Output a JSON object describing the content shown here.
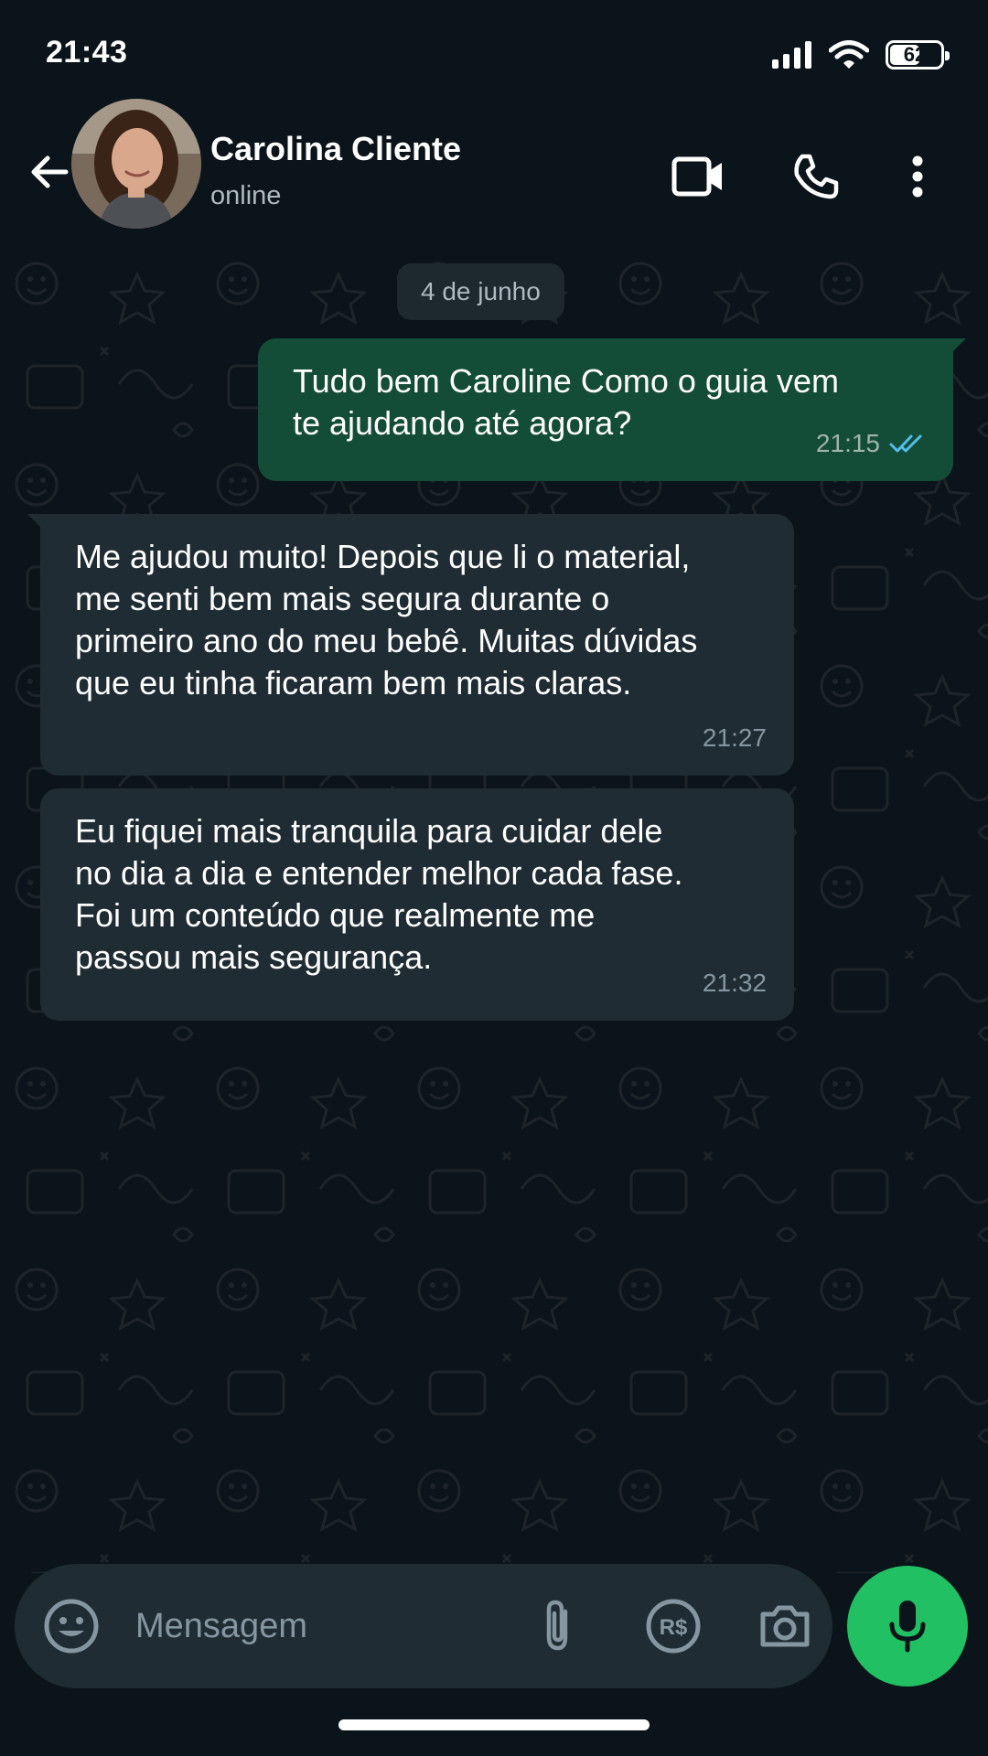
{
  "status_bar": {
    "time": "21:43",
    "battery_level": "62",
    "battery_fraction": 0.62,
    "icons": [
      "signal-icon",
      "wifi-icon",
      "battery-icon"
    ]
  },
  "header": {
    "contact_name": "Carolina Cliente",
    "contact_status": "online",
    "icons": [
      "back-arrow-icon",
      "video-call-icon",
      "phone-call-icon",
      "more-options-icon"
    ]
  },
  "chat": {
    "date_chip": "4 de junho",
    "messages": [
      {
        "direction": "outgoing",
        "text": "Tudo bem  Caroline Como o guia vem\nte ajudando até agora?",
        "time": "21:15",
        "status": "read"
      },
      {
        "direction": "incoming",
        "text": "Me ajudou muito! Depois que li o material,\nme senti bem mais segura durante o\nprimeiro ano do meu bebê. Muitas dúvidas\nque eu tinha ficaram bem mais claras.",
        "time": "21:27"
      },
      {
        "direction": "incoming",
        "text": "Eu fiquei mais tranquila para cuidar dele\nno dia a dia e entender melhor cada fase.\nFoi um conteúdo que realmente me\npassou mais segurança.",
        "time": "21:32"
      }
    ]
  },
  "composer": {
    "placeholder": "Mensagem",
    "icons": [
      "emoji-icon",
      "attachment-icon",
      "payment-icon",
      "camera-icon",
      "microphone-icon"
    ],
    "payment_label": "R$"
  },
  "colors": {
    "background": "#0b141a",
    "outgoing_bubble": "#144d37",
    "incoming_bubble": "#1f2c34",
    "accent_green": "#21c063",
    "read_ticks": "#53bdeb"
  }
}
